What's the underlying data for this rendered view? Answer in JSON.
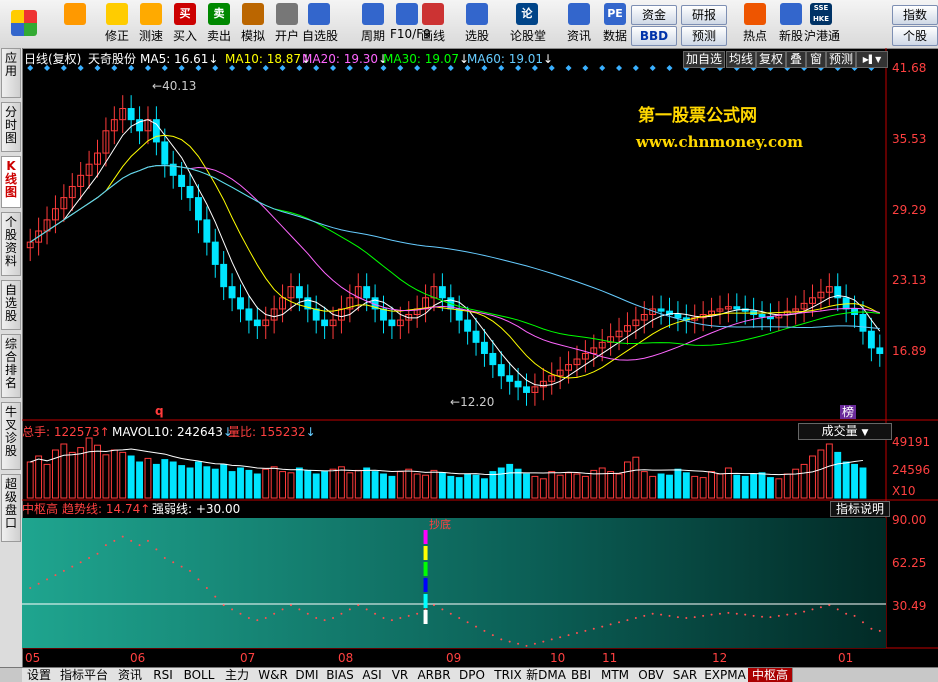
{
  "toolbar": {
    "buttons": [
      {
        "label": "",
        "icon": "windows-logo-icon"
      },
      {
        "label": "",
        "icon": "back-arrow-icon"
      },
      {
        "label": "修正",
        "icon": "refresh-icon"
      },
      {
        "label": "测速",
        "icon": "clock-icon"
      },
      {
        "label": "买入",
        "icon": "buy-icon",
        "glyph": "买"
      },
      {
        "label": "卖出",
        "icon": "sell-icon",
        "glyph": "卖"
      },
      {
        "label": "模拟",
        "icon": "hammer-icon"
      },
      {
        "label": "开户",
        "icon": "lock-icon"
      },
      {
        "label": "自选股",
        "icon": "star-icon"
      },
      {
        "label": "周期",
        "icon": "cycle-icon"
      },
      {
        "label": "F10/F9",
        "icon": "f10-icon"
      },
      {
        "label": "画线",
        "icon": "pen-icon"
      },
      {
        "label": "选股",
        "icon": "screen-icon"
      },
      {
        "label": "论股堂",
        "icon": "forum-icon",
        "glyph": "论"
      },
      {
        "label": "资讯",
        "icon": "news-icon"
      },
      {
        "label": "数据",
        "icon": "pe-icon",
        "glyph": "PE"
      },
      {
        "label": "热点",
        "icon": "fire-icon"
      },
      {
        "label": "新股",
        "icon": "ipo-icon"
      },
      {
        "label": "沪港通",
        "icon": "sse-hke-icon",
        "glyph": "SSE HKE"
      }
    ],
    "text_buttons": [
      "资金",
      "BBD",
      "研报",
      "预测",
      "指数",
      "个股"
    ]
  },
  "left_tabs": [
    "应用",
    "分时图",
    "K线图",
    "个股资料",
    "自选股",
    "综合排名",
    "牛叉诊股",
    "超级盘口"
  ],
  "header": {
    "period": "日线(复权)",
    "stock": "天奇股份",
    "ma": [
      {
        "label": "MA5: 16.61",
        "color": "#ffffff"
      },
      {
        "label": "MA10: 18.87",
        "color": "#ffff00"
      },
      {
        "label": "MA20: 19.30",
        "color": "#ff66ff"
      },
      {
        "label": "MA30: 19.07",
        "color": "#00ff00"
      },
      {
        "label": "MA60: 19.01",
        "color": "#66ccff"
      }
    ],
    "right_buttons": [
      "加自选",
      "均线",
      "复权",
      "叠",
      "窗",
      "预测"
    ]
  },
  "watermark": {
    "title": "第一股票公式网",
    "url": "www.chnmoney.com"
  },
  "price_axis": [
    "41.68",
    "35.53",
    "29.29",
    "23.13",
    "16.89"
  ],
  "price_annotations": {
    "high": "40.13",
    "low": "12.20"
  },
  "markers": {
    "q": "q",
    "rank": "榜"
  },
  "volume": {
    "total_label": "总手: 122573",
    "mavol_label": "MAVOL10: 242643",
    "ratio_label": "量比: 155232",
    "selector": "成交量",
    "axis": [
      "49191",
      "24596",
      "X10"
    ]
  },
  "indicator": {
    "name": "中枢高",
    "trend_label": "趋势线: 14.74",
    "strength_label": "强弱线: +30.00",
    "help_button": "指标说明",
    "axis": [
      "90.00",
      "62.25",
      "30.49"
    ],
    "signal": "抄底"
  },
  "x_axis": [
    "05",
    "06",
    "07",
    "08",
    "09",
    "10",
    "11",
    "12",
    "01"
  ],
  "bottom_tabs": [
    "设置",
    "指标平台",
    "资讯",
    "RSI",
    "BOLL",
    "主力",
    "W&R",
    "DMI",
    "BIAS",
    "ASI",
    "VR",
    "ARBR",
    "DPO",
    "TRIX",
    "新DMA",
    "BBI",
    "MTM",
    "OBV",
    "SAR",
    "EXPMA",
    "中枢高"
  ],
  "colors": {
    "up": "#ff3b3b",
    "down": "#00e5ff",
    "axis": "#c00000",
    "label_red": "#ff4040"
  },
  "series": {
    "close": [
      26,
      27,
      28,
      29,
      30,
      31,
      32,
      33,
      34,
      36,
      37,
      38,
      37,
      36,
      37,
      35,
      33,
      32,
      31,
      30,
      28,
      26,
      24,
      22,
      21,
      20,
      19,
      18.5,
      19,
      20,
      21,
      22,
      21,
      20,
      19,
      18.5,
      19,
      20,
      21,
      22,
      21,
      20,
      19,
      18.5,
      19,
      19.5,
      20,
      21,
      22,
      21,
      20,
      19,
      18,
      17,
      16,
      15,
      14,
      13.5,
      13,
      12.5,
      13,
      13.5,
      14,
      14.5,
      15,
      15.5,
      16,
      16.5,
      17,
      17.5,
      18,
      18.5,
      19,
      19.5,
      20,
      19.8,
      19.5,
      19.2,
      19,
      19.2,
      19.5,
      19.8,
      20,
      20.2,
      20,
      19.8,
      19.5,
      19.3,
      19.2,
      19.5,
      19.8,
      20,
      20.5,
      21,
      21.5,
      22,
      21,
      20,
      19.5,
      18,
      16.5,
      16
    ],
    "volume": [
      30,
      35,
      28,
      40,
      45,
      38,
      42,
      50,
      44,
      36,
      40,
      38,
      35,
      30,
      33,
      28,
      32,
      30,
      27,
      25,
      30,
      26,
      24,
      28,
      22,
      25,
      23,
      20,
      24,
      26,
      22,
      21,
      25,
      23,
      20,
      22,
      24,
      26,
      21,
      23,
      25,
      22,
      20,
      18,
      22,
      24,
      20,
      19,
      23,
      21,
      18,
      17,
      20,
      19,
      16,
      22,
      25,
      28,
      24,
      20,
      18,
      16,
      22,
      19,
      21,
      20,
      18,
      23,
      25,
      22,
      20,
      30,
      34,
      22,
      18,
      20,
      19,
      24,
      21,
      18,
      17,
      22,
      20,
      25,
      19,
      18,
      20,
      21,
      17,
      16,
      20,
      24,
      28,
      35,
      40,
      45,
      38,
      30,
      28,
      25
    ]
  }
}
